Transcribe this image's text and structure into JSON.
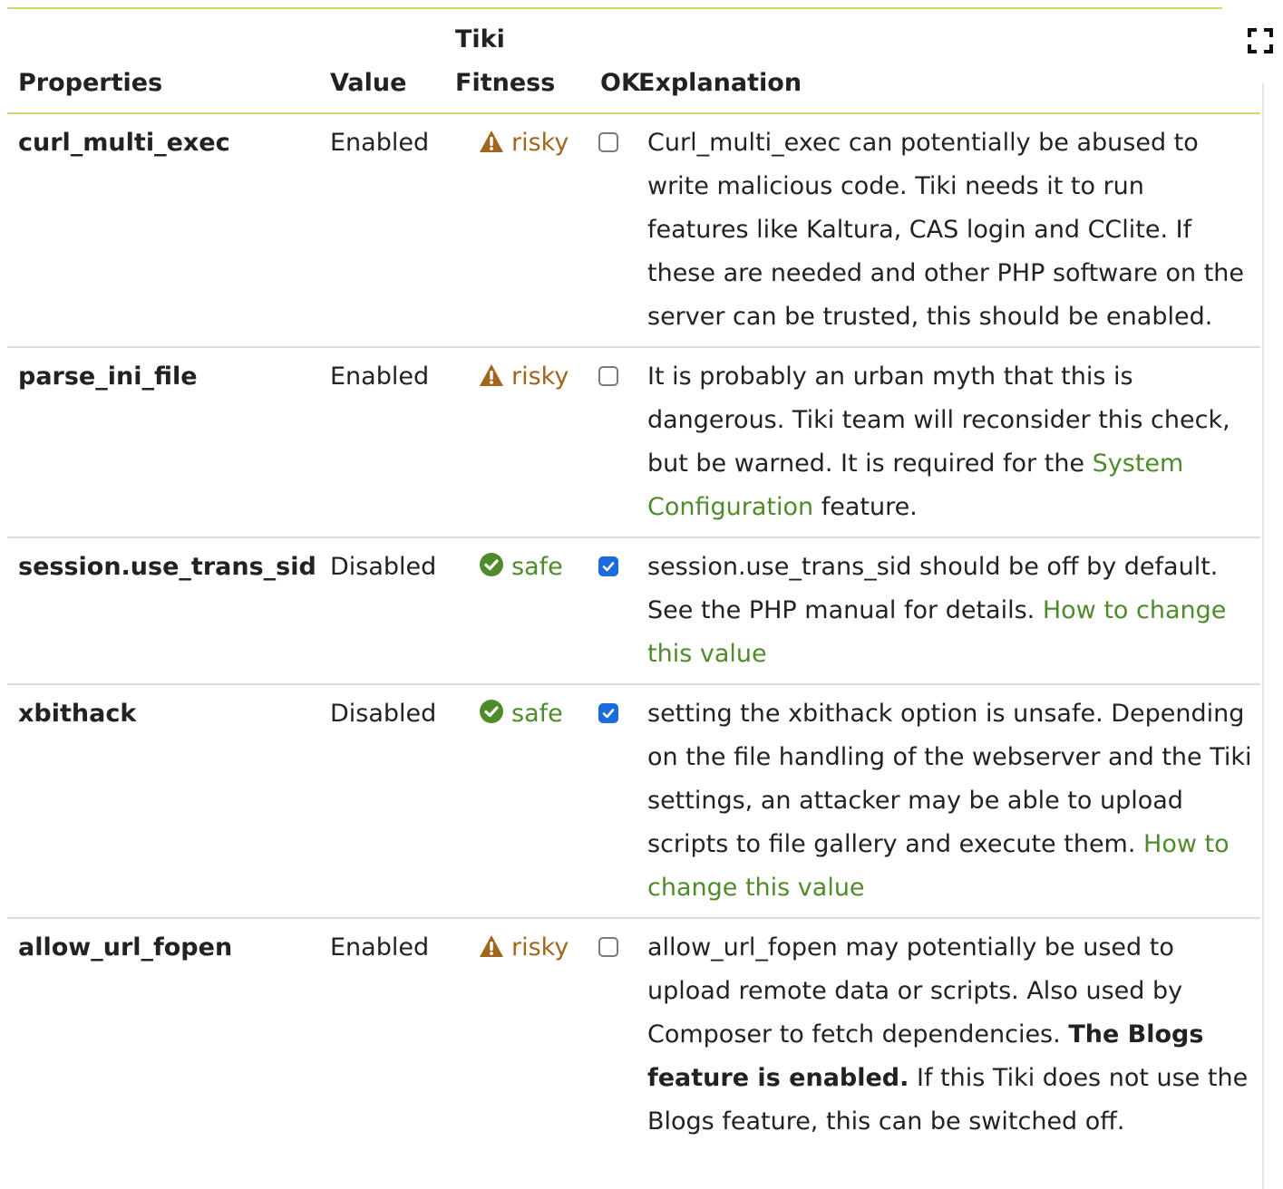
{
  "table": {
    "headers": {
      "properties": "Properties",
      "value": "Value",
      "fitness_line1": "Tiki",
      "fitness_line2": "Fitness",
      "ok": "OK",
      "explanation": "Explanation"
    },
    "rows": [
      {
        "property": "curl_multi_exec",
        "value": "Enabled",
        "fitness": "risky",
        "ok_checked": false,
        "explanation": {
          "text": "Curl_multi_exec can potentially be abused to write malicious code. Tiki needs it to run features like Kaltura, CAS login and CClite. If these are needed and other PHP software on the server can be trusted, this should be enabled."
        }
      },
      {
        "property": "parse_ini_file",
        "value": "Enabled",
        "fitness": "risky",
        "ok_checked": false,
        "explanation": {
          "text": "It is probably an urban myth that this is dangerous. Tiki team will reconsider this check, but be warned. It is required for the",
          "link": "System Configuration",
          "after": "feature."
        }
      },
      {
        "property": "session.use_trans_sid",
        "value": "Disabled",
        "fitness": "safe",
        "ok_checked": true,
        "explanation": {
          "text": "session.use_trans_sid should be off by default. See the PHP manual for details.",
          "link": "How to change this value"
        }
      },
      {
        "property": "xbithack",
        "value": "Disabled",
        "fitness": "safe",
        "ok_checked": true,
        "explanation": {
          "text": "setting the xbithack option is unsafe. Depending on the file handling of the webserver and the Tiki settings, an attacker may be able to upload scripts to file gallery and execute them.",
          "link": "How to change this value"
        }
      },
      {
        "property": "allow_url_fopen",
        "value": "Enabled",
        "fitness": "risky",
        "ok_checked": false,
        "explanation": {
          "text": "allow_url_fopen may potentially be used to upload remote data or scripts. Also used by Composer to fetch dependencies.",
          "bold": "The Blogs feature is enabled.",
          "after": "If this Tiki does not use the Blogs feature, this can be switched off."
        }
      }
    ]
  },
  "colors": {
    "risky": "#a0661b",
    "safe": "#4f8a2b",
    "link": "#4f8a2b",
    "checkbox_checked": "#1a6bdc",
    "header_rule": "#d9d66a"
  },
  "icons": {
    "risky": "warning-triangle-icon",
    "safe": "check-circle-icon",
    "fullscreen": "fullscreen-icon"
  }
}
